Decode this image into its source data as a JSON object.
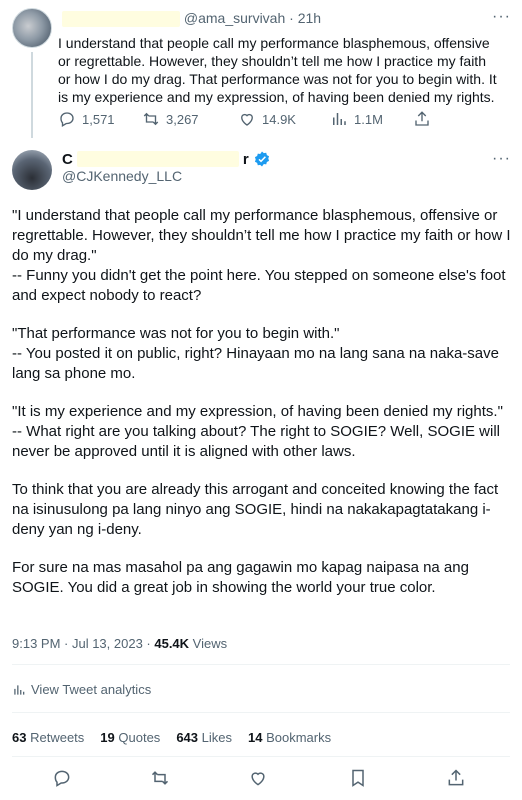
{
  "reply_tweet": {
    "handle": "@ama_survivah",
    "separator": "·",
    "time": "21h",
    "text": "I understand that people call my performance blasphemous, offensive or regrettable. However, they shouldn’t tell me how I practice my faith or how I do my drag. That performance was not for you to begin with. It is my experience and my expression, of having been denied my rights.",
    "stats": {
      "replies": "1,571",
      "retweets": "3,267",
      "likes": "14.9K",
      "views": "1.1M"
    }
  },
  "main_tweet": {
    "name_visible": "C",
    "name_tail": "r",
    "handle": "@CJKennedy_LLC",
    "paragraphs": [
      "\"I understand that people call my performance blasphemous, offensive or regrettable. However, they shouldn’t tell me how I practice my faith or how I do my drag.\"\n-- Funny you didn't get the point here. You stepped on someone else's foot and expect nobody to react?",
      "\"That performance was not for you to begin with.\"\n-- You posted it on public, right? Hinayaan mo na lang sana na naka-save lang sa phone mo.",
      "\"It is my experience and my expression, of having been denied my rights.\"\n-- What right are you talking about? The right to SOGIE? Well, SOGIE will never be approved until it is aligned with other laws.",
      "To think that you are already this arrogant and conceited knowing the fact na isinusulong pa lang ninyo ang SOGIE, hindi na nakakapagtatakang i-deny yan ng i-deny.",
      "For sure na mas masahol pa ang gagawin mo kapag naipasa na ang SOGIE. You did a great job in showing the world your true color."
    ],
    "timestamp": "9:13 PM · Jul 13, 2023 · ",
    "views_count": "45.4K",
    "views_label": " Views",
    "analytics_label": "View Tweet analytics",
    "engagement": {
      "retweets": "63",
      "retweets_label": "Retweets",
      "quotes": "19",
      "quotes_label": "Quotes",
      "likes": "643",
      "likes_label": "Likes",
      "bookmarks": "14",
      "bookmarks_label": "Bookmarks"
    }
  },
  "colors": {
    "text": "#0f1419",
    "muted": "#536471",
    "verified": "#1d9bf0",
    "divider": "#eff3f4"
  }
}
